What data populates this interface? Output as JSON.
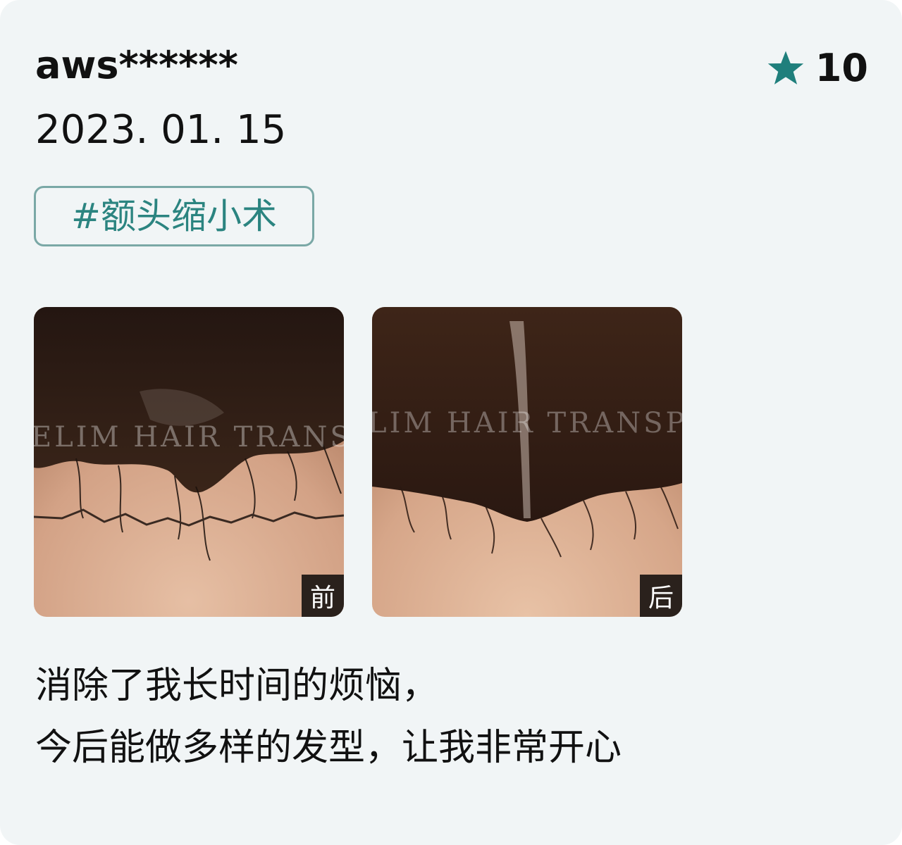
{
  "review": {
    "username": "aws******",
    "rating": "10",
    "date": "2023. 01. 15",
    "tag": "#额头缩小术",
    "photos": [
      {
        "label": "前",
        "watermark": "ELIM HAIR TRANSPL"
      },
      {
        "label": "后",
        "watermark": "LIM HAIR TRANSPL"
      }
    ],
    "text_lines": [
      "消除了我长时间的烦恼，",
      "今后能做多样的发型，让我非常开心"
    ]
  },
  "colors": {
    "accent": "#1f7f7c",
    "tag_border": "#7aa8a6",
    "card_bg": "#f1f5f6",
    "label_bg": "#2a211c"
  },
  "icons": {
    "rating": "star-icon"
  }
}
